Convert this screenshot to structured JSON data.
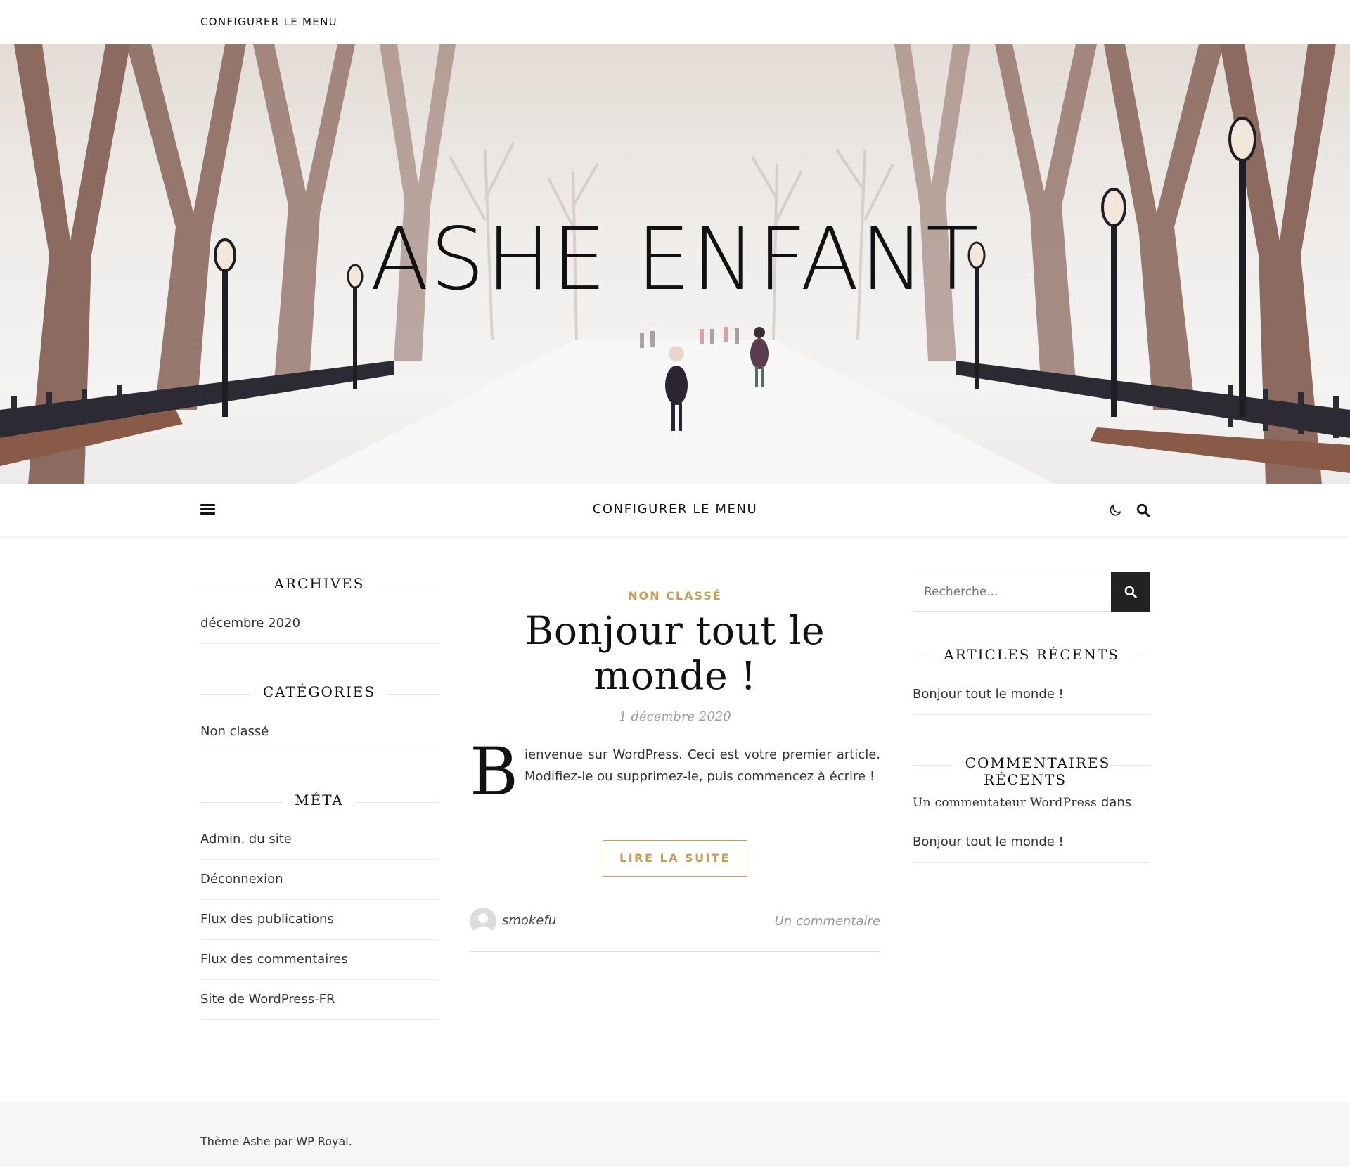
{
  "topbar": {
    "menu_label": "CONFIGURER LE MENU"
  },
  "header": {
    "site_title": "ASHE ENFANT"
  },
  "mainnav": {
    "menu_label": "CONFIGURER LE MENU",
    "icons": [
      "hamburger-icon",
      "moon-icon",
      "search-icon"
    ]
  },
  "left_sidebar": {
    "archives": {
      "title": "ARCHIVES",
      "items": [
        "décembre 2020"
      ]
    },
    "categories": {
      "title": "CATÉGORIES",
      "items": [
        "Non classé"
      ]
    },
    "meta": {
      "title": "MÉTA",
      "items": [
        "Admin. du site",
        "Déconnexion",
        "Flux des publications",
        "Flux des commentaires",
        "Site de WordPress-FR"
      ]
    }
  },
  "post": {
    "category": "NON CLASSÉ",
    "title": "Bonjour tout le monde !",
    "date": "1 décembre 2020",
    "dropcap": "B",
    "excerpt": "ienvenue sur WordPress. Ceci est votre premier article. Modifiez-le ou supprimez-le, puis commencez à écrire !",
    "read_more": "LIRE LA SUITE",
    "author": "smokefu",
    "comments": "Un commentaire"
  },
  "right_sidebar": {
    "search": {
      "placeholder": "Recherche..."
    },
    "recent_posts": {
      "title": "ARTICLES RÉCENTS",
      "items": [
        "Bonjour tout le monde !"
      ]
    },
    "recent_comments": {
      "title": "COMMENTAIRES RÉCENTS",
      "commenter": "Un commentateur WordPress",
      "connector": "dans",
      "post_link": "Bonjour tout le monde !"
    }
  },
  "footer": {
    "credits": "Thème Ashe par WP Royal."
  },
  "colors": {
    "accent": "#ca9b52",
    "text": "#333333",
    "heading": "#111111",
    "footer_bg": "#f6f6f6"
  }
}
